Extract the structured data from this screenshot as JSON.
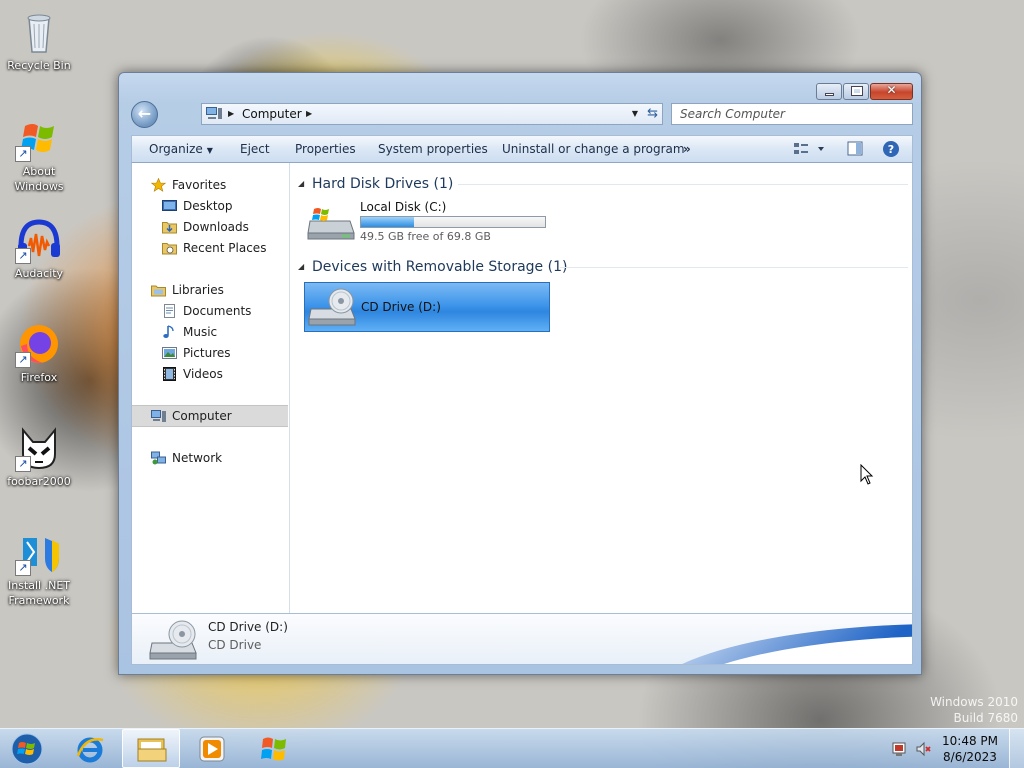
{
  "desktop": {
    "icons": [
      {
        "label": "Recycle Bin"
      },
      {
        "label": "About Windows"
      },
      {
        "label": "Audacity"
      },
      {
        "label": "Firefox"
      },
      {
        "label": "foobar2000"
      },
      {
        "label": "Install .NET Framework"
      }
    ],
    "watermark": {
      "line1": "Windows 2010",
      "line2": "Build 7680"
    }
  },
  "window": {
    "address": {
      "crumb": "Computer",
      "search_placeholder": "Search Computer"
    },
    "toolbar": {
      "organize": "Organize",
      "eject": "Eject",
      "properties": "Properties",
      "system_properties": "System properties",
      "uninstall": "Uninstall or change a program",
      "more": "»"
    },
    "nav": {
      "favorites": "Favorites",
      "desktop": "Desktop",
      "downloads": "Downloads",
      "recent_places": "Recent Places",
      "libraries": "Libraries",
      "documents": "Documents",
      "music": "Music",
      "pictures": "Pictures",
      "videos": "Videos",
      "computer": "Computer",
      "network": "Network"
    },
    "groups": {
      "hdd": "Hard Disk Drives (1)",
      "removable": "Devices with Removable Storage (1)"
    },
    "drives": {
      "local": {
        "name": "Local Disk (C:)",
        "free_text": "49.5 GB free of 69.8 GB",
        "used_fraction": 0.29
      },
      "cd": {
        "name": "CD Drive (D:)"
      }
    },
    "details": {
      "name": "CD Drive (D:)",
      "type": "CD Drive"
    }
  },
  "taskbar": {
    "time": "10:48 PM",
    "date": "8/6/2023"
  },
  "colors": {
    "accent": "#3f96ea",
    "selection": "#2a6fb9"
  }
}
